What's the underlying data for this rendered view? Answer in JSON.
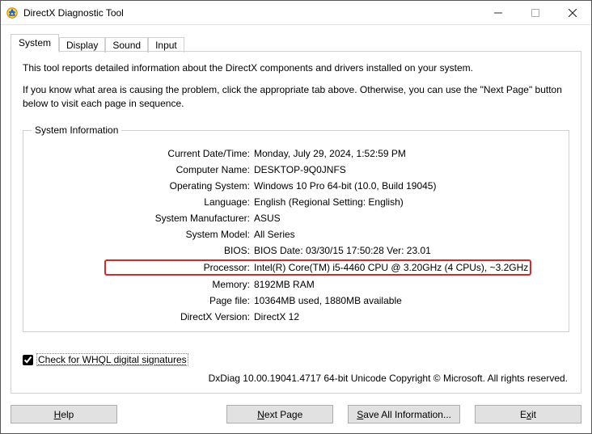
{
  "window": {
    "title": "DirectX Diagnostic Tool"
  },
  "tabs": {
    "system": "System",
    "display": "Display",
    "sound": "Sound",
    "input": "Input"
  },
  "intro": {
    "line1": "This tool reports detailed information about the DirectX components and drivers installed on your system.",
    "line2": "If you know what area is causing the problem, click the appropriate tab above.  Otherwise, you can use the \"Next Page\" button below to visit each page in sequence."
  },
  "sysinfo": {
    "legend": "System Information",
    "rows": {
      "datetime_label": "Current Date/Time:",
      "datetime_value": "Monday, July 29, 2024, 1:52:59 PM",
      "computer_label": "Computer Name:",
      "computer_value": "DESKTOP-9Q0JNFS",
      "os_label": "Operating System:",
      "os_value": "Windows 10 Pro 64-bit (10.0, Build 19045)",
      "lang_label": "Language:",
      "lang_value": "English (Regional Setting: English)",
      "manu_label": "System Manufacturer:",
      "manu_value": "ASUS",
      "model_label": "System Model:",
      "model_value": "All Series",
      "bios_label": "BIOS:",
      "bios_value": "BIOS Date: 03/30/15 17:50:28 Ver: 23.01",
      "proc_label": "Processor:",
      "proc_value": "Intel(R) Core(TM) i5-4460  CPU @ 3.20GHz (4 CPUs), ~3.2GHz",
      "mem_label": "Memory:",
      "mem_value": "8192MB RAM",
      "page_label": "Page file:",
      "page_value": "10364MB used, 1880MB available",
      "dx_label": "DirectX Version:",
      "dx_value": "DirectX 12"
    }
  },
  "whql": {
    "label": "Check for WHQL digital signatures",
    "checked": true
  },
  "copyright": "DxDiag 10.00.19041.4717 64-bit Unicode  Copyright © Microsoft. All rights reserved.",
  "buttons": {
    "help": "Help",
    "help_u": "H",
    "next": "Next Page",
    "next_u": "N",
    "save": "Save All Information...",
    "save_u": "S",
    "exit": "Exit",
    "exit_u": "x"
  }
}
